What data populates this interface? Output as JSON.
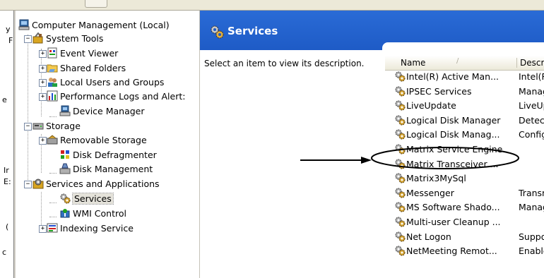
{
  "tree": {
    "root": "Computer Management (Local)",
    "system_tools": "System Tools",
    "event_viewer": "Event Viewer",
    "shared_folders": "Shared Folders",
    "local_users": "Local Users and Groups",
    "perf_logs": "Performance Logs and Alert:",
    "device_manager": "Device Manager",
    "storage": "Storage",
    "removable_storage": "Removable Storage",
    "disk_defrag": "Disk Defragmenter",
    "disk_management": "Disk Management",
    "services_apps": "Services and Applications",
    "services": "Services",
    "wmi_control": "WMI Control",
    "indexing_service": "Indexing Service"
  },
  "pane": {
    "title": "Services",
    "description": "Select an item to view its description.",
    "col_name": "Name",
    "col_desc": "Descri",
    "sort_glyph": "/"
  },
  "services": [
    {
      "name": "Intel(R) Active Man...",
      "desc": "Intel(R"
    },
    {
      "name": "IPSEC Services",
      "desc": "Manag"
    },
    {
      "name": "LiveUpdate",
      "desc": "LiveUp"
    },
    {
      "name": "Logical Disk Manager",
      "desc": "Detect"
    },
    {
      "name": "Logical Disk Manag...",
      "desc": "Config"
    },
    {
      "name": "Matrix Service Engine",
      "desc": ""
    },
    {
      "name": "Matrix Transceiver ...",
      "desc": ""
    },
    {
      "name": "Matrix3MySql",
      "desc": ""
    },
    {
      "name": "Messenger",
      "desc": "Transm"
    },
    {
      "name": "MS Software Shado...",
      "desc": "Manag"
    },
    {
      "name": "Multi-user Cleanup ...",
      "desc": ""
    },
    {
      "name": "Net Logon",
      "desc": "Suppor"
    },
    {
      "name": "NetMeeting Remot...",
      "desc": "Enable"
    }
  ],
  "left_fragments": [
    "y",
    "F",
    "e",
    "Ir",
    "E:",
    "(",
    "c"
  ],
  "colors": {
    "header_blue": "#1e5bc6",
    "annotation": "#000000"
  },
  "icons": {
    "gear": "gear-icon",
    "computer": "computer-icon",
    "folder": "folder-icon"
  }
}
